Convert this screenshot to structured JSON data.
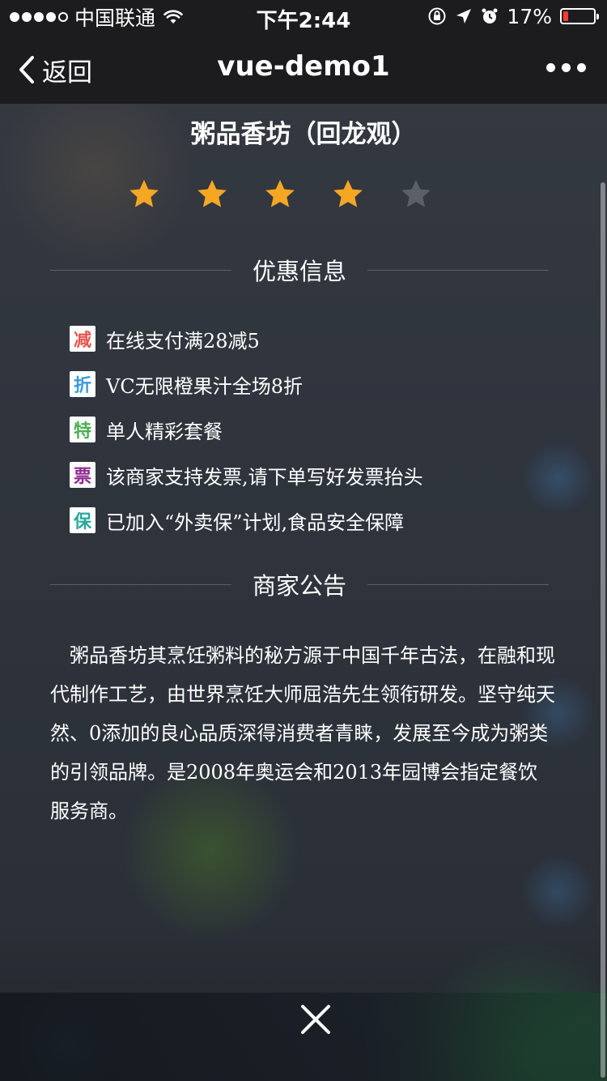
{
  "status_bar": {
    "carrier": "中国联通",
    "time": "下午2:44",
    "battery_percent": "17%",
    "battery_level": 0.17,
    "battery_color": "#ff3b30"
  },
  "nav": {
    "back_label": "返回",
    "title": "vue-demo1",
    "more_icon": "more-dots-icon"
  },
  "shop": {
    "name": "粥品香坊（回龙观）",
    "rating": 4,
    "rating_max": 5,
    "star_active_color": "#f5a623",
    "star_inactive_color": "#5b6068"
  },
  "discount_section": {
    "title": "优惠信息",
    "items": [
      {
        "badge": "减",
        "badge_color": "#e8534e",
        "text": "在线支付满28减5"
      },
      {
        "badge": "折",
        "badge_color": "#3a9ad9",
        "text": "VC无限橙果汁全场8折"
      },
      {
        "badge": "特",
        "badge_color": "#4caf50",
        "text": "单人精彩套餐"
      },
      {
        "badge": "票",
        "badge_color": "#8e2a8e",
        "text": "该商家支持发票,请下单写好发票抬头"
      },
      {
        "badge": "保",
        "badge_color": "#2aa89a",
        "text": "已加入“外卖保”计划,食品安全保障"
      }
    ]
  },
  "bulletin_section": {
    "title": "商家公告",
    "text": "粥品香坊其烹饪粥料的秘方源于中国千年古法，在融和现代制作工艺，由世界烹饪大师屈浩先生领衔研发。坚守纯天然、0添加的良心品质深得消费者青睐，发展至今成为粥类的引领品牌。是2008年奥运会和2013年园博会指定餐饮服务商。"
  },
  "close_icon": "close-icon"
}
